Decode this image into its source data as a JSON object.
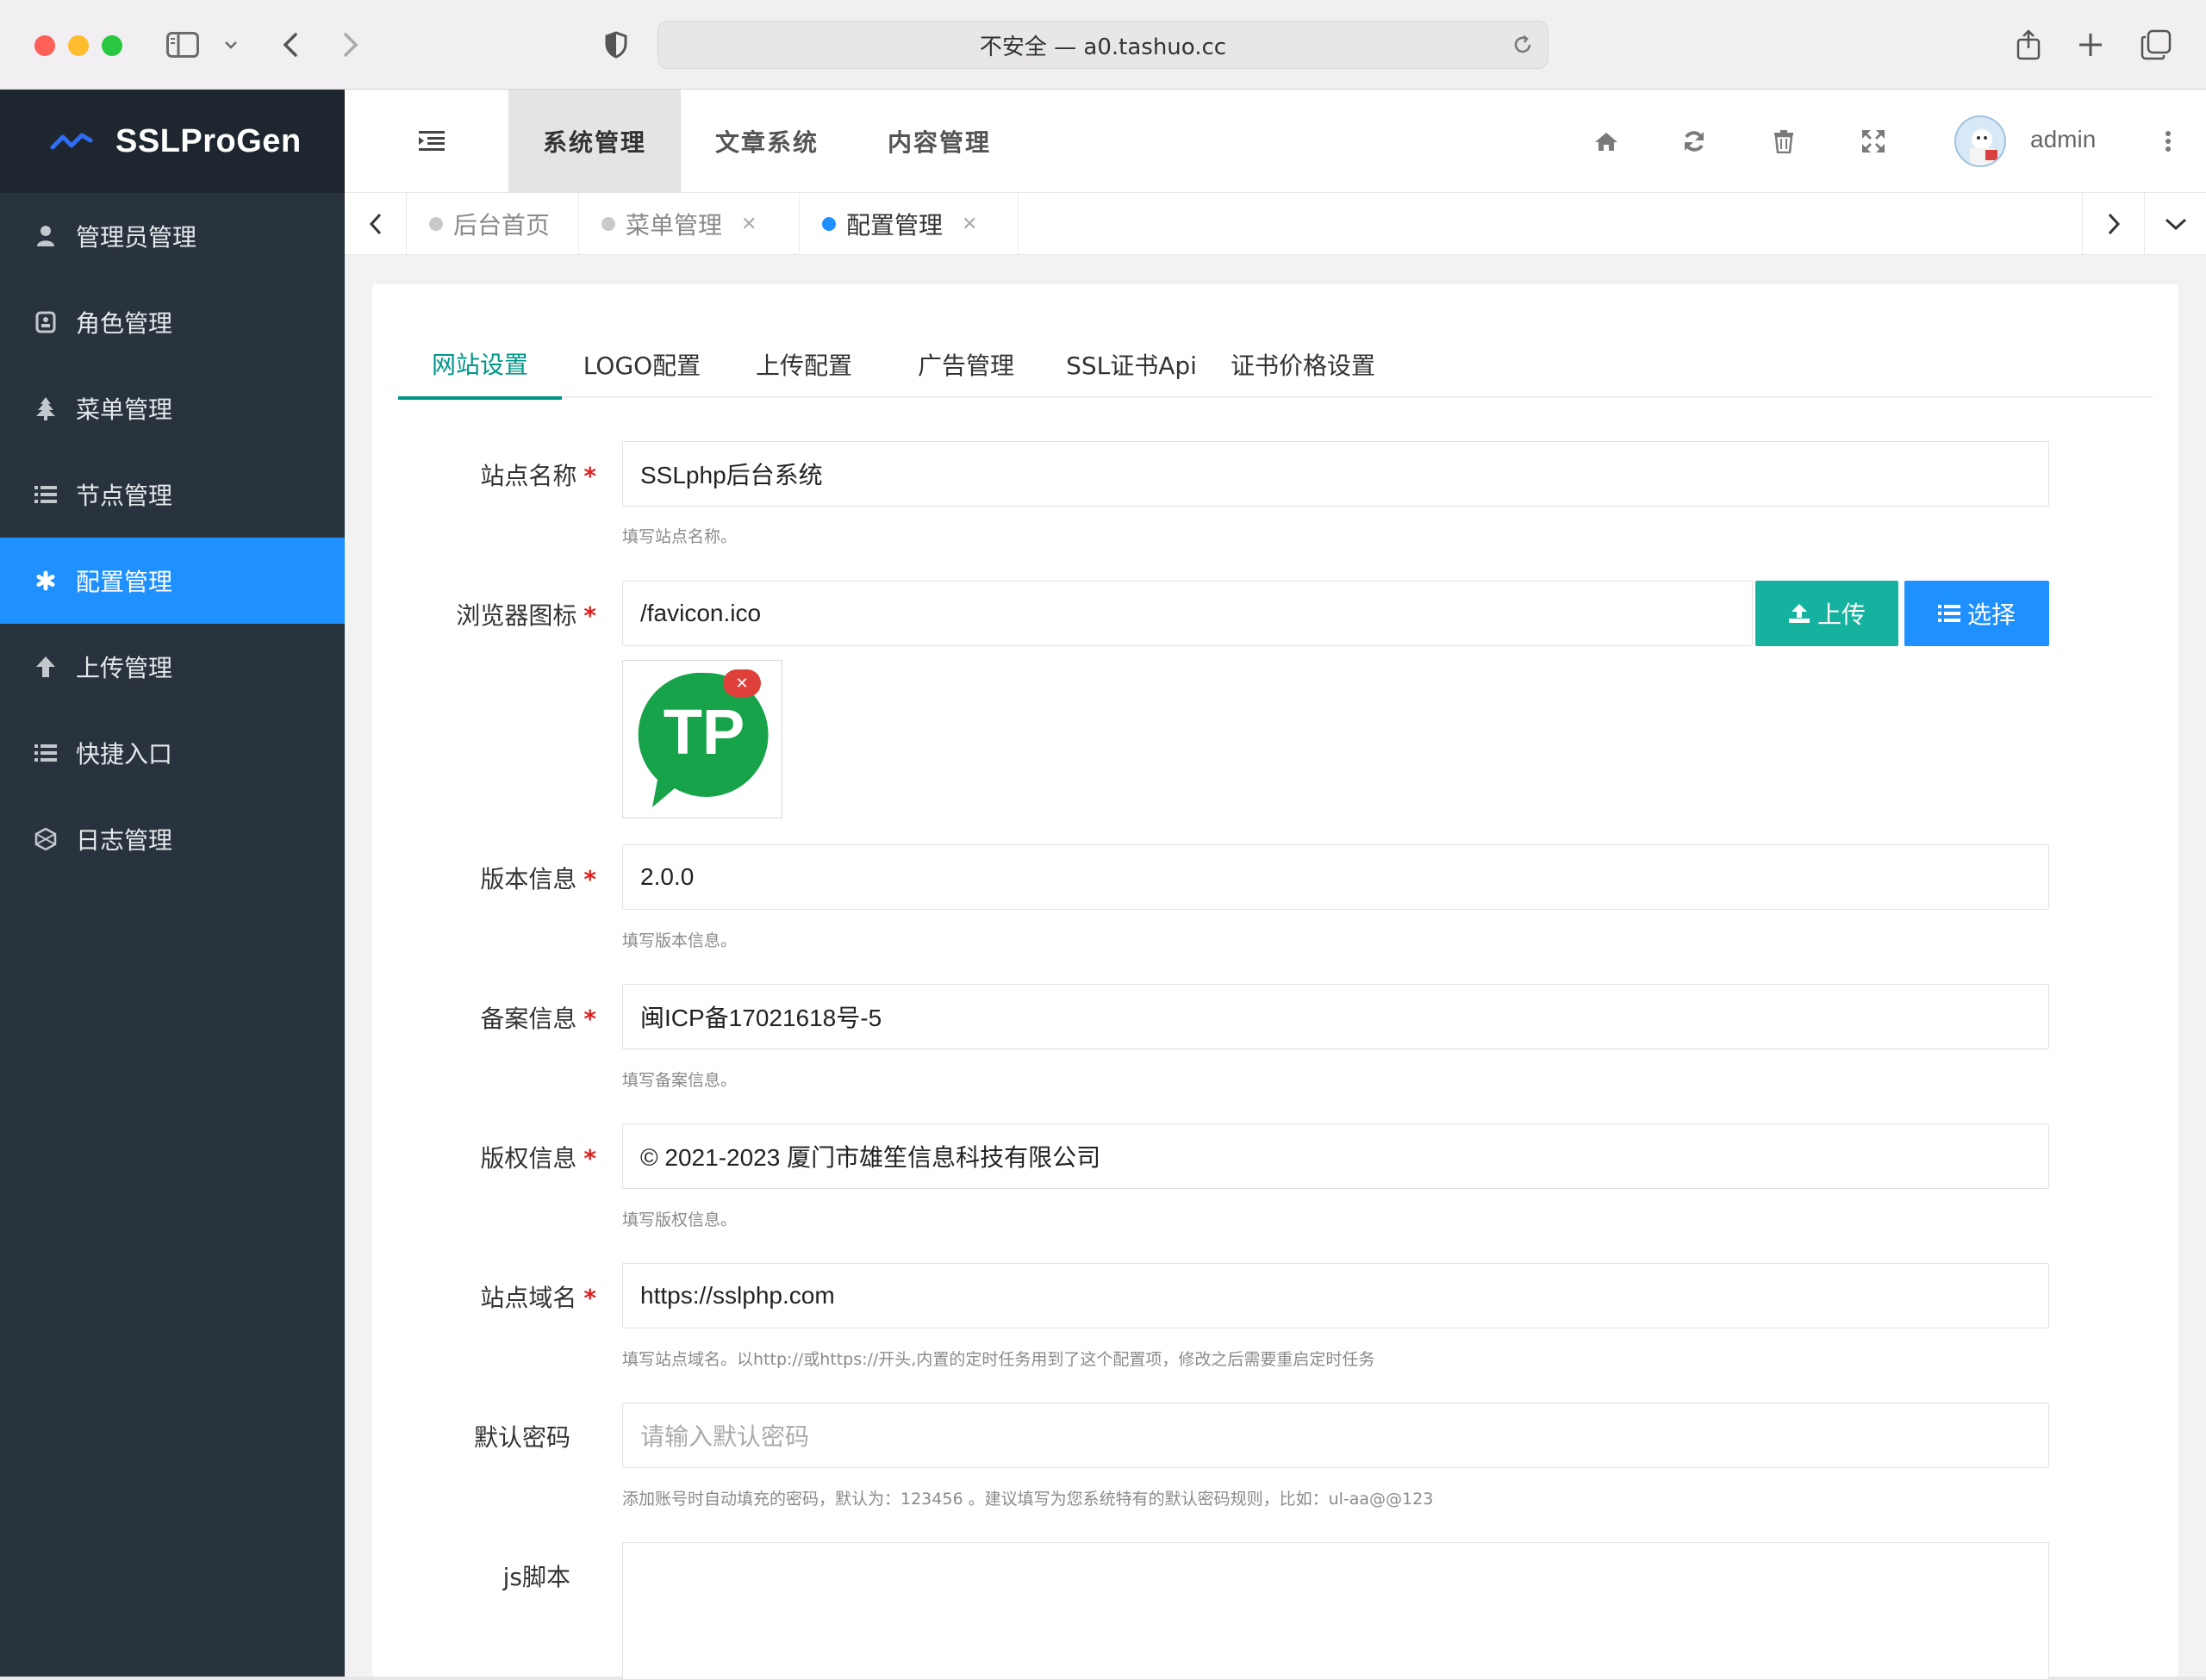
{
  "browser": {
    "url_text": "不安全 — a0.tashuo.cc"
  },
  "sidebar": {
    "brand": "SSLProGen",
    "items": [
      {
        "label": "管理员管理",
        "icon": "user-icon",
        "active": false
      },
      {
        "label": "角色管理",
        "icon": "role-icon",
        "active": false
      },
      {
        "label": "菜单管理",
        "icon": "tree-icon",
        "active": false
      },
      {
        "label": "节点管理",
        "icon": "list-icon",
        "active": false
      },
      {
        "label": "配置管理",
        "icon": "asterisk-icon",
        "active": true
      },
      {
        "label": "上传管理",
        "icon": "arrow-up-icon",
        "active": false
      },
      {
        "label": "快捷入口",
        "icon": "list-icon",
        "active": false
      },
      {
        "label": "日志管理",
        "icon": "globe-icon",
        "active": false
      }
    ]
  },
  "header": {
    "nav": [
      {
        "label": "系统管理",
        "active": true
      },
      {
        "label": "文章系统",
        "active": false
      },
      {
        "label": "内容管理",
        "active": false
      }
    ],
    "username": "admin"
  },
  "page_tabs": [
    {
      "label": "后台首页",
      "closable": false,
      "active": false
    },
    {
      "label": "菜单管理",
      "closable": true,
      "active": false
    },
    {
      "label": "配置管理",
      "closable": true,
      "active": true
    }
  ],
  "config_tabs": [
    {
      "label": "网站设置",
      "active": true
    },
    {
      "label": "LOGO配置",
      "active": false
    },
    {
      "label": "上传配置",
      "active": false
    },
    {
      "label": "广告管理",
      "active": false
    },
    {
      "label": "SSL证书Api",
      "active": false
    },
    {
      "label": "证书价格设置",
      "active": false
    }
  ],
  "form": {
    "site_name": {
      "label": "站点名称",
      "value": "SSLphp后台系统",
      "help": "填写站点名称。",
      "required": true
    },
    "favicon": {
      "label": "浏览器图标",
      "value": "/favicon.ico",
      "required": true,
      "upload_label": "上传",
      "choose_label": "选择",
      "preview_text": "TP"
    },
    "version": {
      "label": "版本信息",
      "value": "2.0.0",
      "help": "填写版本信息。",
      "required": true
    },
    "icp": {
      "label": "备案信息",
      "value": "闽ICP备17021618号-5",
      "help": "填写备案信息。",
      "required": true
    },
    "copyright": {
      "label": "版权信息",
      "value": "© 2021-2023 厦门市雄笙信息科技有限公司",
      "help": "填写版权信息。",
      "required": true
    },
    "domain": {
      "label": "站点域名",
      "value": "https://sslphp.com",
      "help": "填写站点域名。以http://或https://开头,内置的定时任务用到了这个配置项，修改之后需要重启定时任务",
      "required": true
    },
    "default_password": {
      "label": "默认密码",
      "placeholder": "请输入默认密码",
      "help": "添加账号时自动填充的密码，默认为：123456 。建议填写为您系统特有的默认密码规则，比如：ul-aa@@123",
      "required": false
    },
    "js_script": {
      "label": "js脚本",
      "required": false
    }
  },
  "colors": {
    "sidebar_bg": "#28333d",
    "sidebar_active": "#1e90ff",
    "accent_teal": "#009688",
    "upload_button": "#16b2a0",
    "choose_button": "#1e90ff",
    "required_mark": "#e02020"
  }
}
